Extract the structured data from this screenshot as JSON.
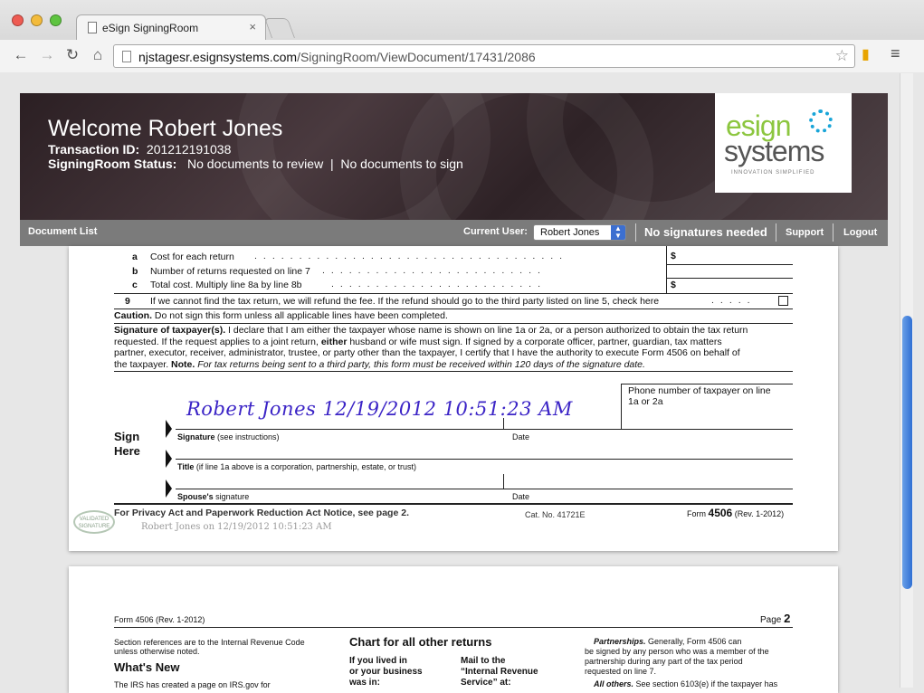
{
  "browser": {
    "tab_title": "eSign SigningRoom",
    "tab_close": "×",
    "url_host": "njstagesr.esignsystems.com",
    "url_path": "/SigningRoom/ViewDocument/17431/2086"
  },
  "header": {
    "welcome": "Welcome Robert Jones",
    "txn_label": "Transaction ID:",
    "txn_value": "201212191038",
    "status_label": "SigningRoom Status:",
    "status_value": "No documents to review  |  No documents to sign",
    "logo_top": "esign",
    "logo_bottom": "systems",
    "logo_tagline": "INNOVATION SIMPLIFIED"
  },
  "nav": {
    "document_list": "Document List",
    "current_user_label": "Current User:",
    "current_user": "Robert Jones",
    "no_signatures": "No signatures needed",
    "support": "Support",
    "logout": "Logout"
  },
  "page1": {
    "line_a_letter": "a",
    "line_a_text": "Cost for each return",
    "line_a_dollar": "$",
    "line_b_letter": "b",
    "line_b_text": "Number of returns requested on line 7",
    "line_c_letter": "c",
    "line_c_text": "Total cost. Multiply line 8a by line 8b",
    "line_c_dollar": "$",
    "line_9_num": "9",
    "line_9_text": "If we cannot find the tax return, we will refund the fee. If the refund should go to the third party listed on line 5, check here",
    "caution_label": "Caution.",
    "caution_text": "Do not sign this form unless all applicable lines have been completed.",
    "sig_label": "Signature of taxpayer(s).",
    "sig_text_1": "I declare that I am either the taxpayer whose name is shown on line 1a or 2a, or a person authorized to obtain the tax return",
    "sig_text_2a": "requested. If the request applies to a joint return,",
    "sig_text_2b": "either",
    "sig_text_2c": "husband or wife must sign. If signed by a corporate officer, partner, guardian, tax  matters",
    "sig_text_3": "partner, executor, receiver, administrator, trustee, or party other than the taxpayer, I certify that I have the authority to execute Form 4506 on behalf of",
    "sig_text_4a": "the taxpayer.",
    "sig_text_4b": "Note.",
    "sig_text_4c": "For tax returns being sent to a third party, this form must be received within 120 days of the signature date.",
    "phone_label_1": "Phone number of taxpayer on line",
    "phone_label_2": "1a or 2a",
    "sign_here_1": "Sign",
    "sign_here_2": "Here",
    "signature_value": "Robert Jones 12/19/2012 10:51:23 AM",
    "signature_label": "Signature",
    "signature_note": "(see instructions)",
    "date_label": "Date",
    "title_label": "Title",
    "title_note": "(if line 1a above is a corporation, partnership, estate, or trust)",
    "spouse_label": "Spouse's",
    "spouse_note": "signature",
    "date_label_2": "Date",
    "privacy_text": "For Privacy Act and Paperwork Reduction Act Notice, see page 2.",
    "cat_no": "Cat. No. 41721E",
    "form_prefix": "Form",
    "form_num": "4506",
    "form_rev": "(Rev. 1-2012)",
    "stamp_text": "VALIDATED SIGNATURE",
    "stamp_sub": "Robert Jones on 12/19/2012 10:51:23 AM"
  },
  "page2": {
    "form_header": "Form 4506 (Rev. 1-2012)",
    "page_label": "Page",
    "page_num": "2",
    "col1_a": "Section references are to the Internal Revenue Code",
    "col1_b": "unless otherwise noted.",
    "whats_new": "What's New",
    "col1_c": "The IRS has created a page on IRS.gov for",
    "chart_title": "Chart for all other returns",
    "col2_h1_a": "If you lived in",
    "col2_h1_b": "or your business",
    "col2_h1_c": "was in:",
    "col2_h2_a": "Mail to the",
    "col2_h2_b": "“Internal Revenue",
    "col2_h2_c": "Service” at:",
    "col3_label": "Partnerships.",
    "col3_a": "Generally, Form 4506 can",
    "col3_b": "be signed by any person who was a member of the",
    "col3_c": "partnership during any part of the tax period",
    "col3_d": "requested on line 7.",
    "col3_e_label": "All others.",
    "col3_e": "See section 6103(e) if the taxpayer has"
  }
}
